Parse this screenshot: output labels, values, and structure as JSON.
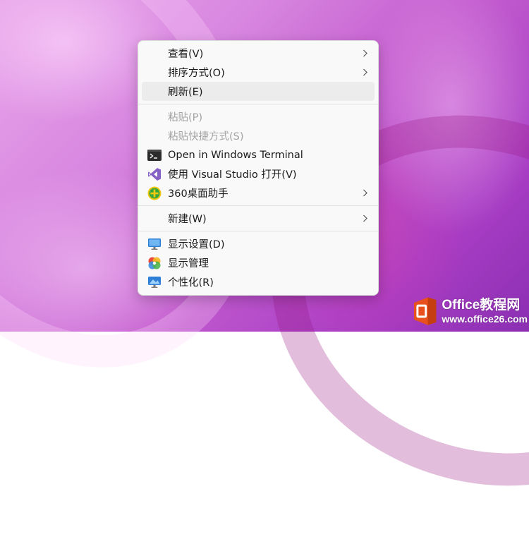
{
  "context_menu": {
    "items": [
      {
        "label": "查看(V)",
        "icon": "",
        "submenu": true,
        "enabled": true
      },
      {
        "label": "排序方式(O)",
        "icon": "",
        "submenu": true,
        "enabled": true
      },
      {
        "label": "刷新(E)",
        "icon": "",
        "submenu": false,
        "enabled": true,
        "highlighted": true
      },
      {
        "label": "粘贴(P)",
        "icon": "",
        "submenu": false,
        "enabled": false
      },
      {
        "label": "粘贴快捷方式(S)",
        "icon": "",
        "submenu": false,
        "enabled": false
      },
      {
        "label": "Open in Windows Terminal",
        "icon": "terminal-icon",
        "submenu": false,
        "enabled": true
      },
      {
        "label": "使用 Visual Studio 打开(V)",
        "icon": "visual-studio-icon",
        "submenu": false,
        "enabled": true
      },
      {
        "label": "360桌面助手",
        "icon": "360-assistant-icon",
        "submenu": true,
        "enabled": true
      },
      {
        "label": "新建(W)",
        "icon": "",
        "submenu": true,
        "enabled": true
      },
      {
        "label": "显示设置(D)",
        "icon": "display-settings-icon",
        "submenu": false,
        "enabled": true
      },
      {
        "label": "显示管理",
        "icon": "display-manager-icon",
        "submenu": false,
        "enabled": true
      },
      {
        "label": "个性化(R)",
        "icon": "personalize-icon",
        "submenu": false,
        "enabled": true
      }
    ]
  },
  "watermark": {
    "title": "Office教程网",
    "url": "www.office26.com",
    "accent": "#e8511d"
  }
}
